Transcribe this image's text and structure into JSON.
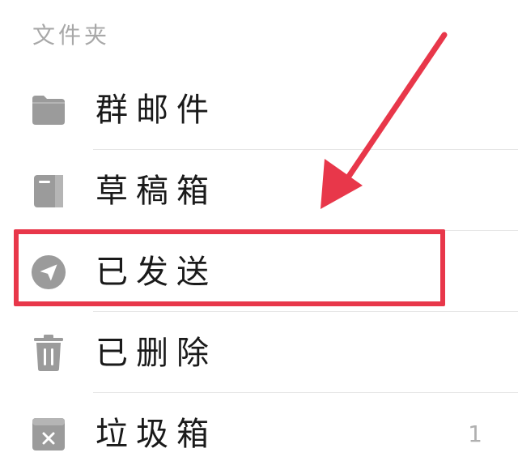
{
  "section": {
    "title": "文件夹"
  },
  "folders": [
    {
      "label": "群邮件",
      "icon": "folder-icon",
      "count": ""
    },
    {
      "label": "草稿箱",
      "icon": "draft-icon",
      "count": ""
    },
    {
      "label": "已发送",
      "icon": "send-icon",
      "count": ""
    },
    {
      "label": "已删除",
      "icon": "trash-icon",
      "count": ""
    },
    {
      "label": "垃圾箱",
      "icon": "spam-icon",
      "count": "1"
    }
  ],
  "colors": {
    "icon": "#9b9b9b",
    "highlight": "#e8374a",
    "divider": "#e6e6e6",
    "section_title": "#a8a8a8"
  }
}
